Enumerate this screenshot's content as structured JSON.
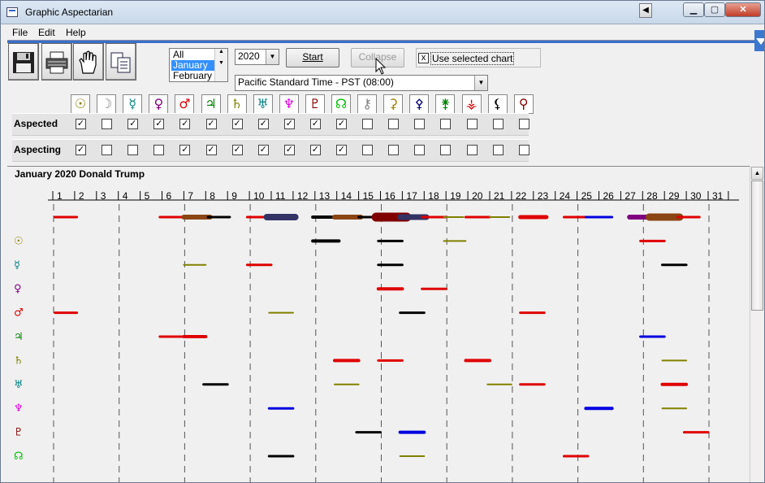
{
  "window": {
    "title": "Graphic Aspectarian"
  },
  "menu": {
    "file": "File",
    "edit": "Edit",
    "help": "Help"
  },
  "toolbar": {
    "save_icon": "floppy-disk-icon",
    "print_icon": "printer-icon",
    "hand_icon": "hand-icon",
    "copy_icon": "copy-icon"
  },
  "controls": {
    "month_list": [
      "All",
      "January",
      "February"
    ],
    "month_selected": "January",
    "year": "2020",
    "start_label": "Start",
    "collapse_label": "Collapse",
    "use_selected_chart_label": "Use selected chart",
    "use_selected_chart_checked": "x",
    "timezone": "Pacific Standard Time - PST (08:00)"
  },
  "planets": [
    {
      "glyph": "☉",
      "color": "#8a7a00"
    },
    {
      "glyph": "☽",
      "color": "#808080"
    },
    {
      "glyph": "☿",
      "color": "#008080"
    },
    {
      "glyph": "♀",
      "color": "#800080"
    },
    {
      "glyph": "♂",
      "color": "#e00000"
    },
    {
      "glyph": "♃",
      "color": "#008000"
    },
    {
      "glyph": "♄",
      "color": "#808000"
    },
    {
      "glyph": "♅",
      "color": "#008080"
    },
    {
      "glyph": "♆",
      "color": "#e000e0"
    },
    {
      "glyph": "♇",
      "color": "#800000"
    },
    {
      "glyph": "☊",
      "color": "#00c000"
    },
    {
      "glyph": "⚷",
      "color": "#808080"
    },
    {
      "glyph": "⚳",
      "color": "#a08000"
    },
    {
      "glyph": "⚴",
      "color": "#000080"
    },
    {
      "glyph": "⚵",
      "color": "#008000"
    },
    {
      "glyph": "⚶",
      "color": "#e00000"
    },
    {
      "glyph": "⚸",
      "color": "#000000"
    },
    {
      "glyph": "⚲",
      "color": "#800000"
    }
  ],
  "aspected": {
    "label": "Aspected",
    "checks": [
      "✓",
      "",
      "✓",
      "✓",
      "✓",
      "✓",
      "✓",
      "✓",
      "✓",
      "✓",
      "✓",
      "",
      "",
      "",
      "",
      "",
      "",
      ""
    ]
  },
  "aspecting": {
    "label": "Aspecting",
    "checks": [
      "✓",
      "",
      "",
      "",
      "✓",
      "✓",
      "✓",
      "✓",
      "✓",
      "✓",
      "✓",
      "",
      "",
      "",
      "",
      "",
      "",
      ""
    ]
  },
  "chart": {
    "title": "January 2020   Donald Trump",
    "days": [
      "1",
      "2",
      "3",
      "4",
      "5",
      "6",
      "7",
      "8",
      "9",
      "10",
      "11",
      "12",
      "13",
      "14",
      "15",
      "16",
      "17",
      "18",
      "19",
      "20",
      "21",
      "22",
      "23",
      "24",
      "25",
      "26",
      "27",
      "28",
      "29",
      "30",
      "31"
    ],
    "row_glyphs": [
      {
        "glyph": "☉",
        "color": "#8a7a00"
      },
      {
        "glyph": "☿",
        "color": "#008080"
      },
      {
        "glyph": "♀",
        "color": "#800080"
      },
      {
        "glyph": "♂",
        "color": "#e00000"
      },
      {
        "glyph": "♃",
        "color": "#008000"
      },
      {
        "glyph": "♄",
        "color": "#808000"
      },
      {
        "glyph": "♅",
        "color": "#008080"
      },
      {
        "glyph": "♆",
        "color": "#e000e0"
      },
      {
        "glyph": "♇",
        "color": "#800000"
      },
      {
        "glyph": "☊",
        "color": "#00c000"
      }
    ],
    "segments": [
      {
        "row": 0,
        "d1": 1.1,
        "d2": 2.1,
        "color": "#e00000",
        "w": 3
      },
      {
        "row": 0,
        "d1": 5.9,
        "d2": 7.1,
        "color": "#e00000",
        "w": 3
      },
      {
        "row": 0,
        "d1": 7.0,
        "d2": 8.2,
        "color": "#8b4513",
        "w": 6
      },
      {
        "row": 0,
        "d1": 8.1,
        "d2": 9.1,
        "color": "#000000",
        "w": 3
      },
      {
        "row": 0,
        "d1": 9.9,
        "d2": 11.0,
        "color": "#e00000",
        "w": 3
      },
      {
        "row": 0,
        "d1": 10.8,
        "d2": 12.1,
        "color": "#333366",
        "w": 8
      },
      {
        "row": 0,
        "d1": 12.9,
        "d2": 14.0,
        "color": "#000000",
        "w": 4
      },
      {
        "row": 0,
        "d1": 13.9,
        "d2": 15.1,
        "color": "#8b4513",
        "w": 6
      },
      {
        "row": 0,
        "d1": 15.0,
        "d2": 16.0,
        "color": "#000000",
        "w": 3
      },
      {
        "row": 0,
        "d1": 15.8,
        "d2": 17.2,
        "color": "#800000",
        "w": 11
      },
      {
        "row": 0,
        "d1": 16.9,
        "d2": 18.1,
        "color": "#333366",
        "w": 7
      },
      {
        "row": 0,
        "d1": 17.9,
        "d2": 19.0,
        "color": "#e00000",
        "w": 3
      },
      {
        "row": 0,
        "d1": 18.9,
        "d2": 19.8,
        "color": "#808000",
        "w": 2
      },
      {
        "row": 0,
        "d1": 19.9,
        "d2": 21.0,
        "color": "#e00000",
        "w": 3
      },
      {
        "row": 0,
        "d1": 21.0,
        "d2": 21.9,
        "color": "#808000",
        "w": 2
      },
      {
        "row": 0,
        "d1": 22.4,
        "d2": 23.6,
        "color": "#e00000",
        "w": 5
      },
      {
        "row": 0,
        "d1": 24.4,
        "d2": 25.4,
        "color": "#e00000",
        "w": 3
      },
      {
        "row": 0,
        "d1": 25.4,
        "d2": 26.6,
        "color": "#0000e0",
        "w": 3
      },
      {
        "row": 0,
        "d1": 27.4,
        "d2": 28.4,
        "color": "#800080",
        "w": 6
      },
      {
        "row": 0,
        "d1": 28.3,
        "d2": 29.7,
        "color": "#8b4513",
        "w": 9
      },
      {
        "row": 0,
        "d1": 29.6,
        "d2": 30.6,
        "color": "#e00000",
        "w": 3
      },
      {
        "row": 1,
        "d1": 12.9,
        "d2": 14.1,
        "color": "#000000",
        "w": 4
      },
      {
        "row": 1,
        "d1": 15.9,
        "d2": 17.0,
        "color": "#000000",
        "w": 3
      },
      {
        "row": 1,
        "d1": 18.9,
        "d2": 19.9,
        "color": "#808000",
        "w": 2
      },
      {
        "row": 1,
        "d1": 27.9,
        "d2": 29.0,
        "color": "#e00000",
        "w": 3
      },
      {
        "row": 2,
        "d1": 7.0,
        "d2": 8.0,
        "color": "#808000",
        "w": 2
      },
      {
        "row": 2,
        "d1": 9.9,
        "d2": 11.0,
        "color": "#e00000",
        "w": 3
      },
      {
        "row": 2,
        "d1": 15.9,
        "d2": 17.0,
        "color": "#000000",
        "w": 3
      },
      {
        "row": 2,
        "d1": 28.9,
        "d2": 30.0,
        "color": "#000000",
        "w": 3
      },
      {
        "row": 3,
        "d1": 15.9,
        "d2": 17.0,
        "color": "#e00000",
        "w": 4
      },
      {
        "row": 3,
        "d1": 17.9,
        "d2": 19.0,
        "color": "#e00000",
        "w": 3
      },
      {
        "row": 4,
        "d1": 1.1,
        "d2": 2.1,
        "color": "#e00000",
        "w": 3
      },
      {
        "row": 4,
        "d1": 10.9,
        "d2": 12.0,
        "color": "#808000",
        "w": 2
      },
      {
        "row": 4,
        "d1": 16.9,
        "d2": 18.0,
        "color": "#000000",
        "w": 3
      },
      {
        "row": 4,
        "d1": 22.4,
        "d2": 23.5,
        "color": "#e00000",
        "w": 3
      },
      {
        "row": 5,
        "d1": 5.9,
        "d2": 7.0,
        "color": "#e00000",
        "w": 3
      },
      {
        "row": 5,
        "d1": 7.0,
        "d2": 8.0,
        "color": "#e00000",
        "w": 4
      },
      {
        "row": 5,
        "d1": 27.9,
        "d2": 29.0,
        "color": "#0000e0",
        "w": 3
      },
      {
        "row": 6,
        "d1": 13.9,
        "d2": 15.0,
        "color": "#e00000",
        "w": 4
      },
      {
        "row": 6,
        "d1": 15.9,
        "d2": 17.0,
        "color": "#e00000",
        "w": 3
      },
      {
        "row": 6,
        "d1": 19.9,
        "d2": 21.0,
        "color": "#e00000",
        "w": 4
      },
      {
        "row": 6,
        "d1": 28.9,
        "d2": 30.0,
        "color": "#808000",
        "w": 2
      },
      {
        "row": 7,
        "d1": 7.9,
        "d2": 9.0,
        "color": "#000000",
        "w": 3
      },
      {
        "row": 7,
        "d1": 13.9,
        "d2": 15.0,
        "color": "#808000",
        "w": 2
      },
      {
        "row": 7,
        "d1": 20.9,
        "d2": 22.0,
        "color": "#808000",
        "w": 2
      },
      {
        "row": 7,
        "d1": 22.4,
        "d2": 23.5,
        "color": "#e00000",
        "w": 3
      },
      {
        "row": 7,
        "d1": 28.9,
        "d2": 30.0,
        "color": "#e00000",
        "w": 4
      },
      {
        "row": 8,
        "d1": 10.9,
        "d2": 12.0,
        "color": "#0000e0",
        "w": 3
      },
      {
        "row": 8,
        "d1": 25.4,
        "d2": 26.6,
        "color": "#0000e0",
        "w": 4
      },
      {
        "row": 8,
        "d1": 28.9,
        "d2": 30.0,
        "color": "#808000",
        "w": 2
      },
      {
        "row": 9,
        "d1": 14.9,
        "d2": 16.0,
        "color": "#000000",
        "w": 3
      },
      {
        "row": 9,
        "d1": 16.9,
        "d2": 18.0,
        "color": "#0000e0",
        "w": 4
      },
      {
        "row": 9,
        "d1": 29.9,
        "d2": 31.0,
        "color": "#e00000",
        "w": 3
      },
      {
        "row": 10,
        "d1": 10.9,
        "d2": 12.0,
        "color": "#000000",
        "w": 3
      },
      {
        "row": 10,
        "d1": 16.9,
        "d2": 18.0,
        "color": "#808000",
        "w": 2
      },
      {
        "row": 10,
        "d1": 24.4,
        "d2": 25.5,
        "color": "#e00000",
        "w": 3
      }
    ]
  }
}
